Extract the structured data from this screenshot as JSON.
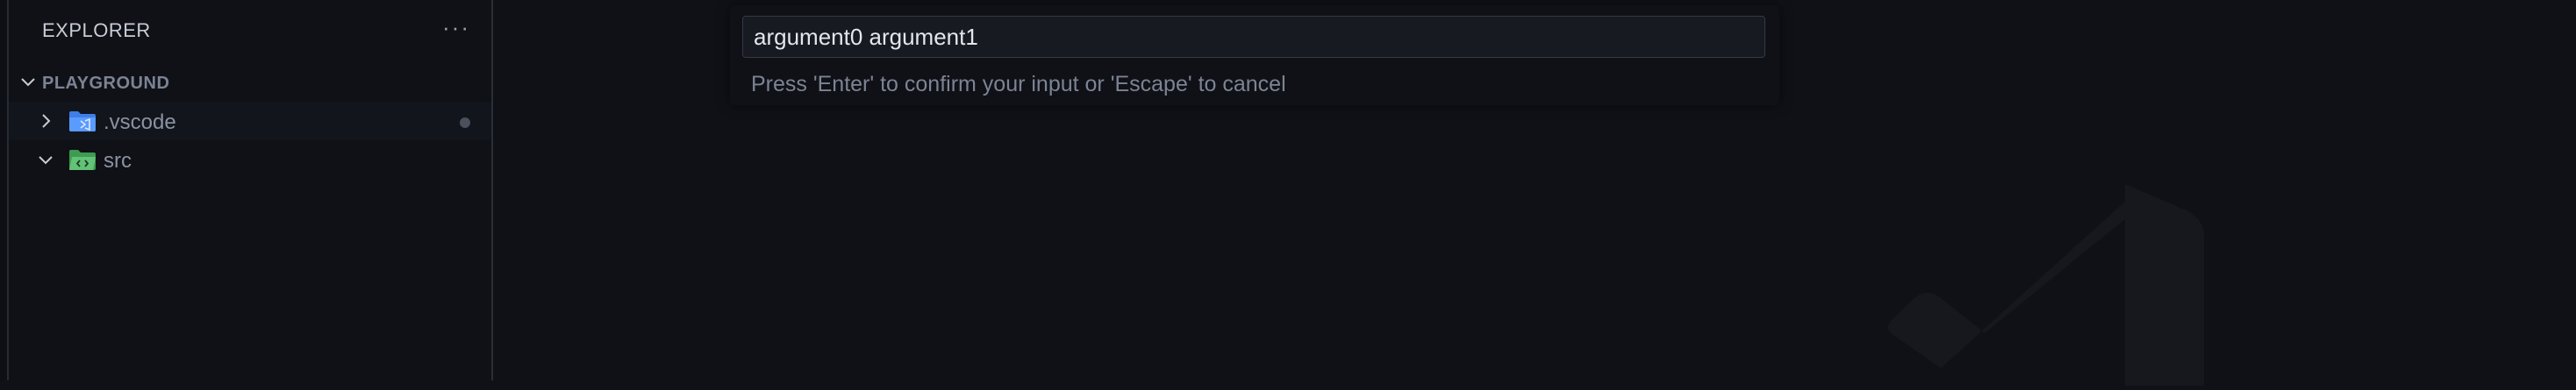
{
  "sidebar": {
    "title": "EXPLORER",
    "more_icon": "ellipsis-icon",
    "section": {
      "label": "PLAYGROUND",
      "expanded": true
    },
    "items": [
      {
        "label": ".vscode",
        "expanded": false,
        "icon": "vscode-folder-icon",
        "folder_color": "#4a8cf7",
        "selected": true,
        "modified": true
      },
      {
        "label": "src",
        "expanded": true,
        "icon": "src-folder-icon",
        "folder_color": "#56b86a",
        "selected": false,
        "modified": false
      }
    ]
  },
  "quick_input": {
    "value": "argument0 argument1",
    "message": "Press 'Enter' to confirm your input or 'Escape' to cancel"
  },
  "colors": {
    "background": "#0f1117",
    "accent": "#4a8cf7"
  }
}
